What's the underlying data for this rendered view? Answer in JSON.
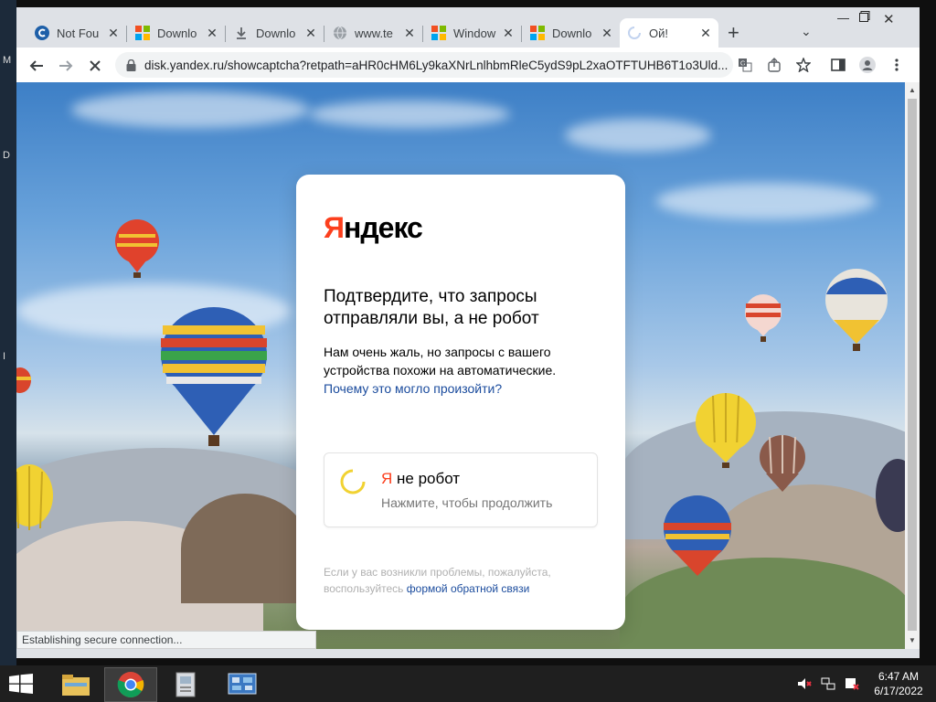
{
  "desktop": {
    "side_letters": [
      "M",
      "D",
      "I"
    ]
  },
  "tabs": [
    {
      "label": "Not Fou",
      "icon": "c-logo-icon"
    },
    {
      "label": "Downlo",
      "icon": "windows-logo-icon"
    },
    {
      "label": "Downlo",
      "icon": "download-icon"
    },
    {
      "label": "www.te",
      "icon": "globe-icon"
    },
    {
      "label": "Window",
      "icon": "windows-logo-icon"
    },
    {
      "label": "Downlo",
      "icon": "windows-logo-icon"
    },
    {
      "label": "Ой!",
      "icon": "loading-spinner-icon",
      "active": true
    }
  ],
  "toolbar": {
    "url": "disk.yandex.ru/showcaptcha?retpath=aHR0cHM6Ly9kaXNrLnlhbmRleC5ydS9pL2xaOTFTUHB6T1o3Uld..."
  },
  "card": {
    "logo_ya": "Я",
    "logo_rest": "ндекс",
    "title": "Подтвердите, что запросы отправляли вы, а не робот",
    "desc_text": "Нам очень жаль, но запросы с вашего устройства похожи на автоматические. ",
    "desc_link": "Почему это могло произойти?",
    "robot_ya": "Я",
    "robot_label": " не робот",
    "robot_hint": "Нажмите, чтобы продолжить",
    "foot_text": "Если у вас возникли проблемы, пожалуйста, воспользуйтесь ",
    "foot_link": "формой обратной связи"
  },
  "status": {
    "text": "Establishing secure connection..."
  },
  "clock": {
    "time": "6:47 AM",
    "date": "6/17/2022"
  },
  "colors": {
    "yandex_red": "#fc3f1d",
    "link_blue": "#1a4b9d"
  }
}
